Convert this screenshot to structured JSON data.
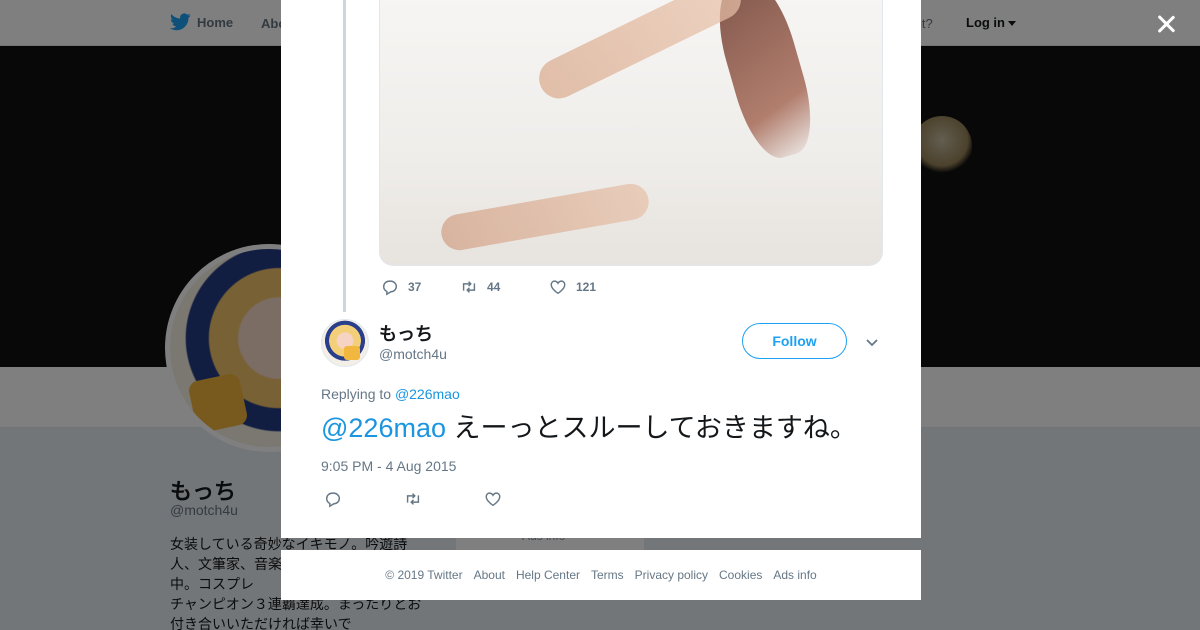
{
  "topnav": {
    "home_label": "Home",
    "about_label": "Abo",
    "account_prompt": "account?",
    "login_label": "Log in"
  },
  "profile": {
    "name": "もっち",
    "handle": "@motch4u",
    "bio": "女装している奇妙なイキモノ。吟遊詩人、文筆家、音楽　　　　　　　　漫遊中。コスプレ　　　　　　　　ーム全欧チャンピオン３連覇達成。まったりとお付き合いいただければ幸いで",
    "side_card_text": "Ads info"
  },
  "parent_tweet": {
    "replies": "37",
    "retweets": "44",
    "likes": "121"
  },
  "reply_tweet": {
    "name": "もっち",
    "handle": "@motch4u",
    "follow_label": "Follow",
    "replying_prefix": "Replying to",
    "replying_handle": "@226mao",
    "mention": "@226mao",
    "text": " えーっとスルーしておきますね。",
    "timestamp": "9:05 PM - 4 Aug 2015"
  },
  "footer": {
    "links": [
      "© 2019 Twitter",
      "About",
      "Help Center",
      "Terms",
      "Privacy policy",
      "Cookies",
      "Ads info"
    ]
  },
  "colors": {
    "twitter_blue": "#1da1f2",
    "link_blue": "#1b95e0",
    "muted_text": "#657786",
    "overlay": "rgba(0,0,0,0.5)"
  },
  "icons": [
    "twitter-bird-icon",
    "close-icon",
    "reply-icon",
    "retweet-icon",
    "like-icon",
    "chevron-down-icon"
  ]
}
